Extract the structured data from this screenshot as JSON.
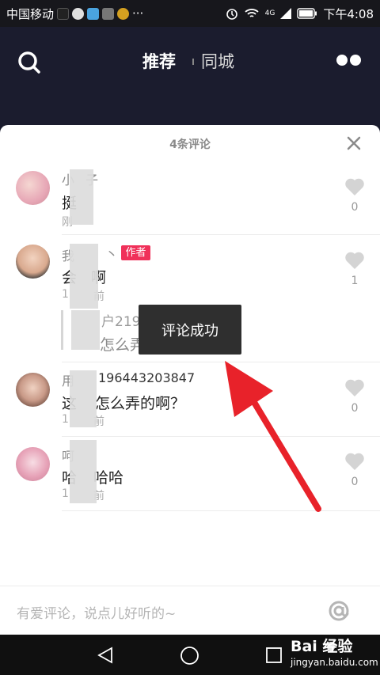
{
  "status_bar": {
    "carrier": "中国移动",
    "more": "···",
    "time": "下午4:08",
    "network": "4G"
  },
  "nav": {
    "active_tab": "推荐",
    "other_tab": "同城"
  },
  "sheet": {
    "title": "4条评论"
  },
  "comments": [
    {
      "name": "小",
      "name_tail": "子",
      "text": "挺",
      "time": "刚",
      "likes": "0"
    },
    {
      "name": "我",
      "name_tail": "丶",
      "badge": "作者",
      "text": "会",
      "text_tail": "啊",
      "time": "1",
      "time_tail": "前",
      "likes": "1",
      "reply_user_tail": "户2196443203847",
      "reply_text_tail": "怎么弄的啊？"
    },
    {
      "name": "用",
      "name_tail": "196443203847",
      "text": "这",
      "text_tail": "怎么弄的啊？",
      "time": "1",
      "time_tail": "前",
      "likes": "0"
    },
    {
      "name": "呵",
      "text": "哈",
      "text_tail": "哈哈",
      "time": "1",
      "time_tail": "前",
      "likes": "0"
    }
  ],
  "toast": "评论成功",
  "input": {
    "placeholder": "有爱评论，说点儿好听的~"
  },
  "watermark": {
    "brand": "Bai 经验",
    "domain": "jingyan.baidu.com"
  },
  "colors": {
    "accent": "#f0315a",
    "arrow": "#e8222a",
    "nav_bg": "#1b1c2e"
  }
}
